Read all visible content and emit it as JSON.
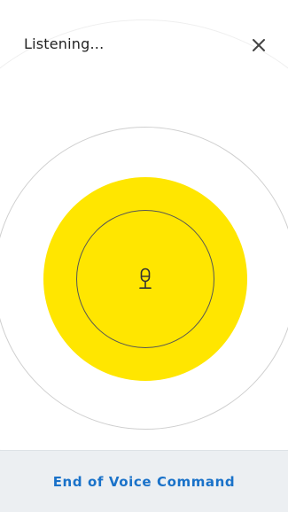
{
  "header": {
    "title": "Listening..."
  },
  "icons": {
    "close": "close-icon",
    "mic": "microphone-icon"
  },
  "colors": {
    "accent_yellow": "#ffe600",
    "action_blue": "#1a72c9",
    "footer_bg": "#eceff2"
  },
  "footer": {
    "end_label": "End of Voice Command"
  }
}
